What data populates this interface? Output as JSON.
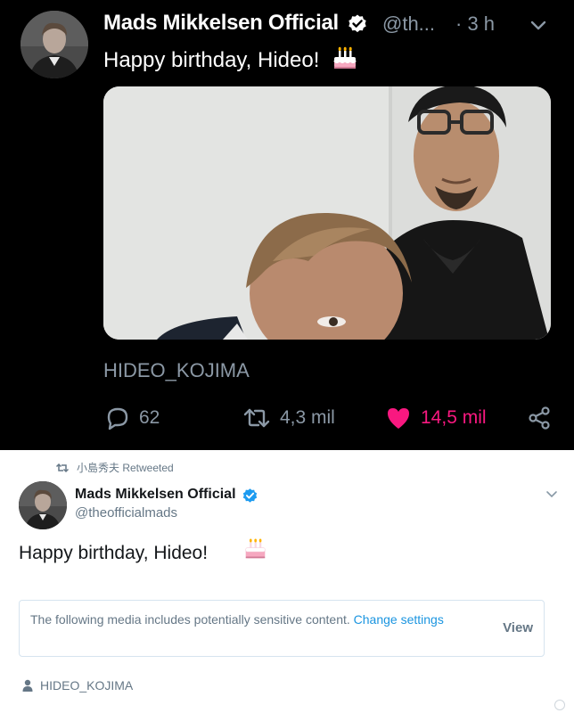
{
  "dark_tweet": {
    "author_name": "Mads Mikkelsen Official",
    "handle": "@th...",
    "time": "· 3 h",
    "text": "Happy birthday, Hideo!",
    "tagged_user": "HIDEO_KOJIMA",
    "replies": "62",
    "retweets": "4,3 mil",
    "likes": "14,5 mil",
    "colors": {
      "background": "#000000",
      "like_active": "#f91880",
      "verified": "#1d9bf0"
    },
    "icons": [
      "verified-badge-icon",
      "chevron-down-icon",
      "birthday-cake-emoji",
      "reply-icon",
      "retweet-icon",
      "heart-icon",
      "share-icon"
    ]
  },
  "light_tweet": {
    "retweeted_by": "小島秀夫 Retweeted",
    "author_name": "Mads Mikkelsen Official",
    "handle": "@theofficialmads",
    "text": "Happy birthday, Hideo!",
    "sensitive_notice": "The following media includes potentially sensitive content.",
    "change_settings": "Change settings",
    "view_label": "View",
    "tagged_user": "HIDEO_KOJIMA",
    "colors": {
      "background": "#ffffff",
      "link": "#1b95e0",
      "muted": "#657786"
    },
    "icons": [
      "retweet-icon",
      "verified-badge-icon",
      "chevron-down-icon",
      "birthday-cake-emoji",
      "person-icon"
    ]
  }
}
